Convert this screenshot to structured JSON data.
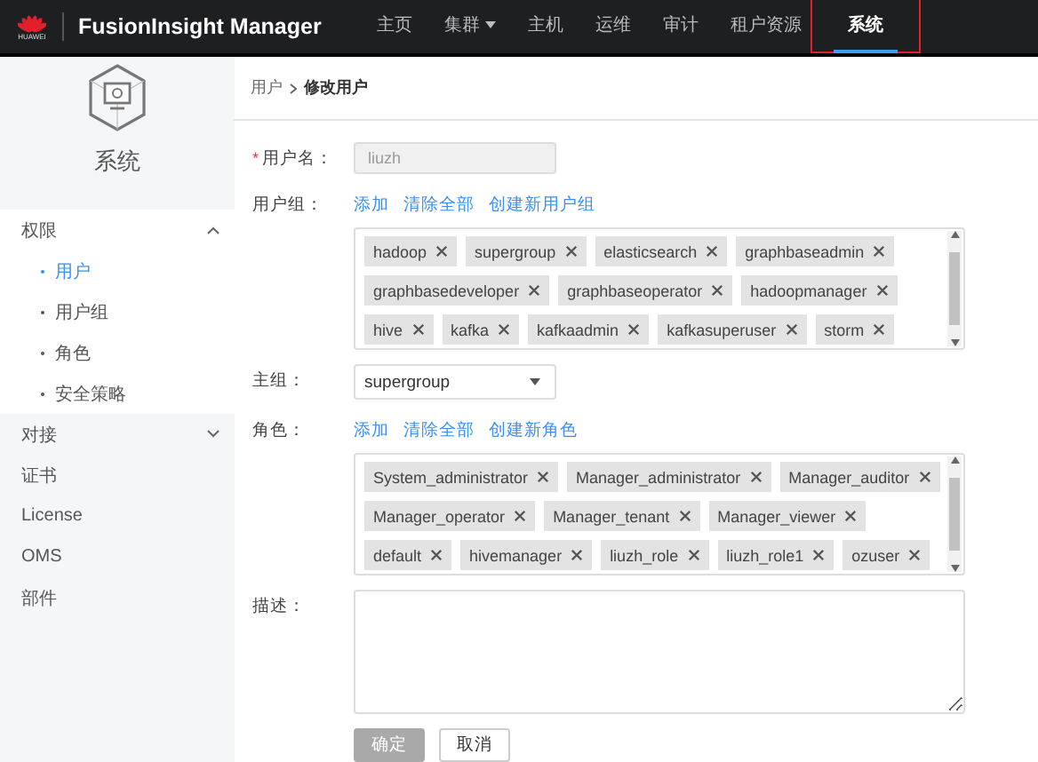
{
  "header": {
    "logo_text": "HUAWEI",
    "product": "FusionInsight Manager",
    "nav": [
      {
        "label": "主页",
        "selected": false,
        "dropdown": false,
        "highlighted": false
      },
      {
        "label": "集群",
        "selected": false,
        "dropdown": true,
        "highlighted": false
      },
      {
        "label": "主机",
        "selected": false,
        "dropdown": false,
        "highlighted": false
      },
      {
        "label": "运维",
        "selected": false,
        "dropdown": false,
        "highlighted": false
      },
      {
        "label": "审计",
        "selected": false,
        "dropdown": false,
        "highlighted": false
      },
      {
        "label": "租户资源",
        "selected": false,
        "dropdown": false,
        "highlighted": false
      },
      {
        "label": "系统",
        "selected": true,
        "dropdown": false,
        "highlighted": true
      }
    ]
  },
  "sidebar": {
    "title": "系统",
    "items": [
      {
        "label": "权限",
        "expanded": true,
        "children": [
          {
            "label": "用户",
            "selected": true
          },
          {
            "label": "用户组",
            "selected": false
          },
          {
            "label": "角色",
            "selected": false
          },
          {
            "label": "安全策略",
            "selected": false
          }
        ]
      },
      {
        "label": "对接",
        "expanded": false
      },
      {
        "label": "证书"
      },
      {
        "label": "License"
      },
      {
        "label": "OMS"
      },
      {
        "label": "部件"
      }
    ]
  },
  "breadcrumb": [
    "用户",
    "修改用户"
  ],
  "form": {
    "username": {
      "label": "用户名：",
      "required_mark": "*",
      "value": "liuzh",
      "disabled": true
    },
    "user_groups": {
      "label": "用户组：",
      "actions": [
        "添加",
        "清除全部",
        "创建新用户组"
      ],
      "tags": [
        "hadoop",
        "supergroup",
        "elasticsearch",
        "graphbaseadmin",
        "graphbasedeveloper",
        "graphbaseoperator",
        "hadoopmanager",
        "hive",
        "kafka",
        "kafkaadmin",
        "kafkasuperuser",
        "storm"
      ]
    },
    "primary_group": {
      "label": "主组：",
      "value": "supergroup"
    },
    "roles": {
      "label": "角色：",
      "actions": [
        "添加",
        "清除全部",
        "创建新角色"
      ],
      "tags": [
        "System_administrator",
        "Manager_administrator",
        "Manager_auditor",
        "Manager_operator",
        "Manager_tenant",
        "Manager_viewer",
        "default",
        "hivemanager",
        "liuzh_role",
        "liuzh_role1",
        "ozuser"
      ]
    },
    "description": {
      "label": "描述："
    },
    "buttons": [
      {
        "label": "确定",
        "disabled": true
      },
      {
        "label": "取消",
        "disabled": false
      }
    ]
  }
}
